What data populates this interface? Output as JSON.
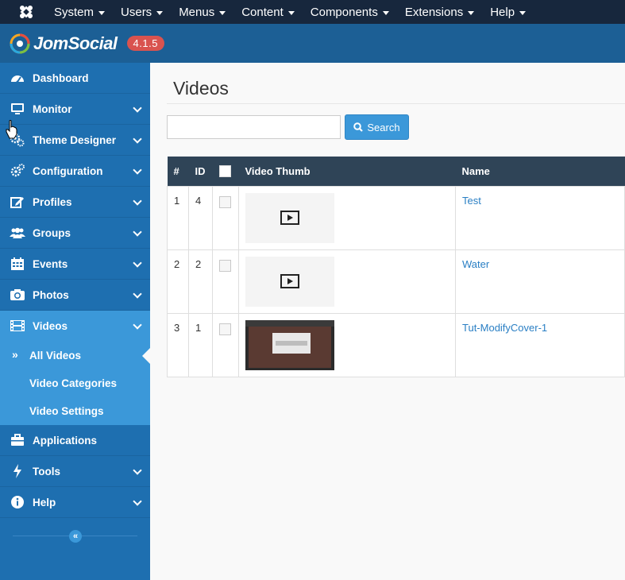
{
  "topbar": {
    "menu": [
      {
        "label": "System"
      },
      {
        "label": "Users"
      },
      {
        "label": "Menus"
      },
      {
        "label": "Content"
      },
      {
        "label": "Components"
      },
      {
        "label": "Extensions"
      },
      {
        "label": "Help"
      }
    ]
  },
  "brand": {
    "name": "JomSocial",
    "version": "4.1.5"
  },
  "sidebar": {
    "items": [
      {
        "label": "Dashboard",
        "icon": "dashboard-icon",
        "has_children": false
      },
      {
        "label": "Monitor",
        "icon": "monitor-icon",
        "has_children": true
      },
      {
        "label": "Theme Designer",
        "icon": "cogs-icon",
        "has_children": true
      },
      {
        "label": "Configuration",
        "icon": "gears-icon",
        "has_children": true
      },
      {
        "label": "Profiles",
        "icon": "edit-icon",
        "has_children": true
      },
      {
        "label": "Groups",
        "icon": "users-icon",
        "has_children": true
      },
      {
        "label": "Events",
        "icon": "calendar-icon",
        "has_children": true
      },
      {
        "label": "Photos",
        "icon": "camera-icon",
        "has_children": true
      },
      {
        "label": "Videos",
        "icon": "film-icon",
        "has_children": true,
        "active": true
      }
    ],
    "videos_sub": [
      {
        "label": "All Videos",
        "current": true
      },
      {
        "label": "Video Categories"
      },
      {
        "label": "Video Settings"
      }
    ],
    "items_after": [
      {
        "label": "Applications",
        "icon": "briefcase-icon",
        "has_children": false
      },
      {
        "label": "Tools",
        "icon": "bolt-icon",
        "has_children": true
      },
      {
        "label": "Help",
        "icon": "info-icon",
        "has_children": true
      }
    ],
    "collapse_symbol": "«"
  },
  "main": {
    "title": "Videos",
    "search": {
      "value": "",
      "placeholder": "",
      "button_label": "Search"
    },
    "table": {
      "columns": [
        "#",
        "ID",
        "",
        "Video Thumb",
        "Name"
      ],
      "rows": [
        {
          "num": "1",
          "id": "4",
          "thumb": "placeholder",
          "name": "Test"
        },
        {
          "num": "2",
          "id": "2",
          "thumb": "placeholder",
          "name": "Water"
        },
        {
          "num": "3",
          "id": "1",
          "thumb": "screenshot",
          "name": "Tut-ModifyCover-1"
        }
      ]
    }
  },
  "colors": {
    "topbar": "#17273d",
    "brandbar": "#1c5f95",
    "sidebar": "#1e6fb0",
    "sidebar_active": "#3b98d9",
    "version_badge": "#d9534f",
    "table_header": "#2f4457",
    "link": "#2a7fc4"
  }
}
